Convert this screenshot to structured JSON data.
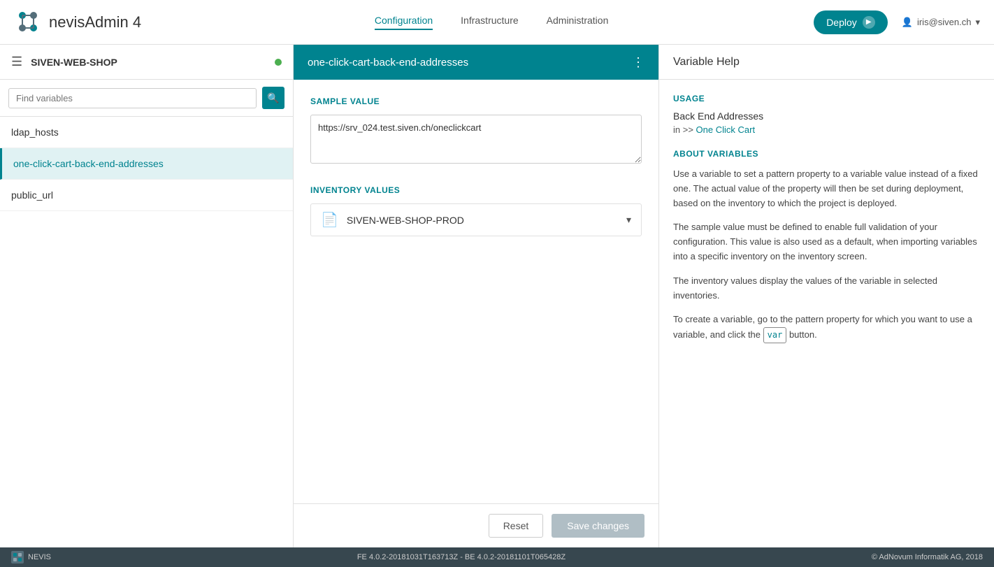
{
  "app": {
    "title": "nevisAdmin 4",
    "logo_alt": "nevisAdmin logo"
  },
  "topnav": {
    "links": [
      {
        "label": "Configuration",
        "active": true
      },
      {
        "label": "Infrastructure",
        "active": false
      },
      {
        "label": "Administration",
        "active": false
      }
    ],
    "deploy_label": "Deploy",
    "user": "iris@siven.ch"
  },
  "sidebar": {
    "title": "SIVEN-WEB-SHOP",
    "search_placeholder": "Find variables",
    "items": [
      {
        "label": "ldap_hosts",
        "active": false
      },
      {
        "label": "one-click-cart-back-end-addresses",
        "active": true
      },
      {
        "label": "public_url",
        "active": false
      }
    ]
  },
  "content": {
    "header_title": "one-click-cart-back-end-addresses",
    "sample_value_label": "SAMPLE VALUE",
    "sample_value_text": "https://srv_024.test.siven.ch/oneclickcart",
    "inventory_label": "INVENTORY VALUES",
    "inventory_item": "SIVEN-WEB-SHOP-PROD",
    "reset_label": "Reset",
    "save_label": "Save changes"
  },
  "right_panel": {
    "header": "Variable Help",
    "usage_title": "USAGE",
    "usage_value": "Back End Addresses",
    "usage_in": "in >>",
    "usage_link": "One Click Cart",
    "about_title": "ABOUT VARIABLES",
    "about_paragraphs": [
      "Use a variable to set a pattern property to a variable value instead of a fixed one. The actual value of the property will then be set during deployment, based on the inventory to which the project is deployed.",
      "The sample value must be defined to enable full validation of your configuration. This value is also used as a default, when importing variables into a specific inventory on the inventory screen.",
      "The inventory values display the values of the variable in selected inventories.",
      "To create a variable, go to the pattern property for which you want to use a variable, and click the"
    ],
    "var_badge": "var",
    "after_badge": "button."
  },
  "statusbar": {
    "version": "FE 4.0.2-20181031T163713Z - BE 4.0.2-20181101T065428Z",
    "copyright": "© AdNovum Informatik AG, 2018",
    "nevis_label": "NEVIS"
  }
}
